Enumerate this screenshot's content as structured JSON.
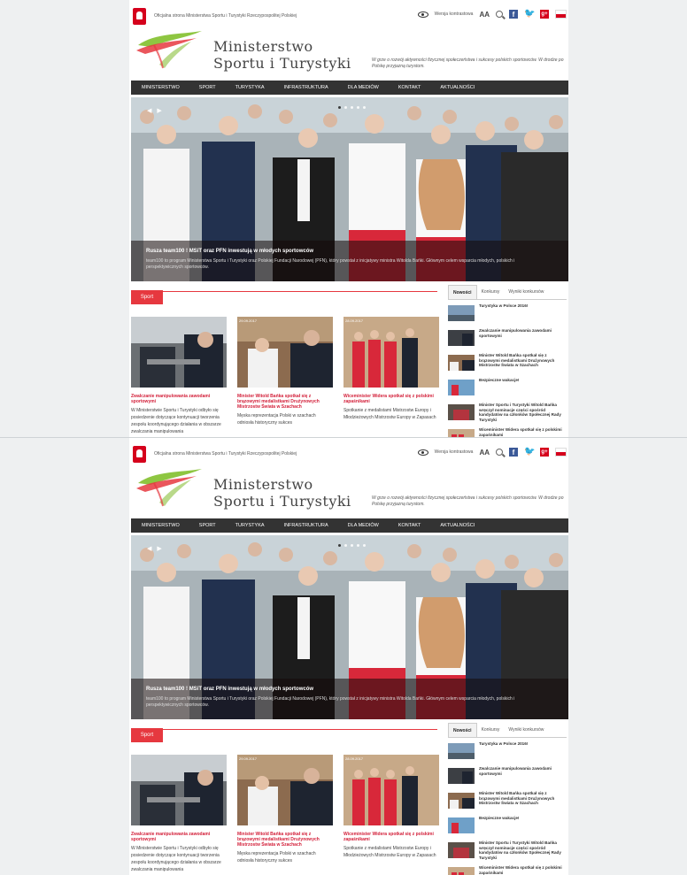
{
  "header": {
    "official_text": "Oficjalna strona Ministerstwa Sportu i Turystyki Rzeczypospolitej Polskiej",
    "contrast_label": "Wersja kontrastowa",
    "font_size_label": "AA",
    "logo_line1": "Ministerstwo",
    "logo_line2": "Sportu i Turystyki",
    "tagline": "W grze o rozwój aktywności fizycznej społeczeństwa i sukcesy polskich sportowców. W drodze po Polskę przyjazną turystom."
  },
  "nav": {
    "items": [
      "MINISTERSTWO",
      "SPORT",
      "TURYSTYKA",
      "INFRASTRUKTURA",
      "DLA MEDIÓW",
      "KONTAKT",
      "AKTUALNOŚCI"
    ]
  },
  "hero": {
    "title": "Rusza team100 ! MSiT oraz PFN inwestują w młodych sportowców",
    "text": "team100 to program Ministerstwa Sportu i Turystyki oraz Polskiej Fundacji Narodowej (PFN), który powstał z inicjatywy ministra Witolda Bańki. Głównym celem wsparcia młodych, polskich i perspektywicznych sportowców."
  },
  "section": {
    "label": "Sport"
  },
  "articles": [
    {
      "date": "",
      "title": "Zwalczanie manipulowania zawodami sportowymi",
      "excerpt": "W Ministerstwie Sportu i Turystyki odbyło się posiedzenie dotyczące kontynuacji tworzenia zespołu koordynującego działania w obszarze zwalczania manipulowania"
    },
    {
      "date": "29.09.2017",
      "title": "Minister Witold Bańka spotkał się z brązowymi medalistkami Drużynowych Mistrzostw Świata w Szachach",
      "excerpt": "Męska reprezentacja Polski w szachach odniosła historyczny sukces"
    },
    {
      "date": "28.09.2017",
      "title": "Wiceminister Widera spotkał się z polskimi zapaśnikami",
      "excerpt": "Spotkanie z medalistami Mistrzostw Europy i Młodzieżowych Mistrzostw Europy w Zapasach"
    }
  ],
  "sidebar": {
    "tabs": [
      "Nowości",
      "Konkursy",
      "Wyniki konkursów"
    ],
    "items": [
      "Turystyka w Polsce 2016!",
      "Zwalczanie manipulowania zawodami sportowymi",
      "Minister Witold Bańka spotkał się z brązowymi medalistkami Drużynowych Mistrzostw Świata w Szachach",
      "Bezpieczne wakacje!",
      "Minister Sportu i Turystyki Witold Bańka wręczył nominacje części spośród kandydatów na członków Społecznej Rady Turystyki",
      "Wiceminister Widera spotkał się z polskimi zapaśnikami"
    ]
  },
  "colors": {
    "accent_red": "#e6383f",
    "nav_dark": "#333333",
    "link_red": "#d3203a",
    "facebook": "#3b5998",
    "twitter": "#1da1f2"
  },
  "icons": [
    "eagle-emblem-icon",
    "eye-icon",
    "search-icon",
    "facebook-icon",
    "twitter-icon",
    "gplus-icon",
    "flag-icon",
    "arrow-left-icon",
    "arrow-right-icon"
  ]
}
